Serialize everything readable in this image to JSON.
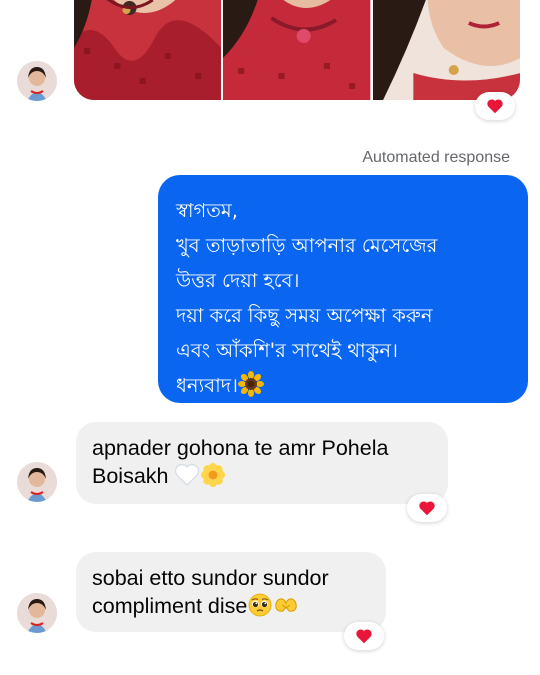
{
  "conversation": {
    "top_photos": {
      "alt_count": 3
    },
    "automated_label": "Automated response",
    "outgoing_message": {
      "lines": [
        "স্বাগতম,",
        "খুব তাড়াতাড়ি আপনার মেসেজের",
        "উত্তর দেয়া হবে।",
        "দয়া করে কিছু সময় অপেক্ষা করুন",
        "এবং আঁকশি'র সাথেই থাকুন।",
        "ধন্যবাদ।"
      ],
      "trailing_emoji": "sunflower-emoji"
    },
    "incoming_messages": [
      {
        "lines": [
          "apnader gohona te amr Pohela",
          "Boisakh"
        ],
        "emojis": [
          "white-heart-emoji",
          "blossom-emoji"
        ],
        "reaction": "heart-icon"
      },
      {
        "lines": [
          "sobai etto sundor sundor",
          "compliment dise"
        ],
        "emojis": [
          "pleading-face-emoji",
          "heart-hands-emoji"
        ],
        "reaction": "heart-icon"
      }
    ]
  },
  "colors": {
    "outgoing_bubble": "#0a66f0",
    "incoming_bubble": "#f0f0f0",
    "reaction_heart": "#e8173a",
    "label_gray": "#65676b"
  }
}
